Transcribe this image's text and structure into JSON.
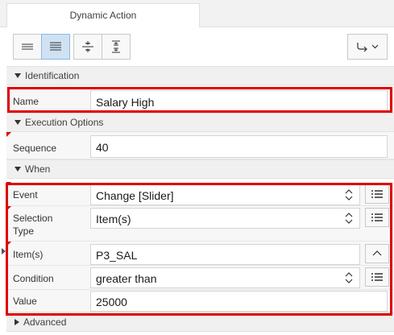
{
  "tab": {
    "label": "Dynamic Action"
  },
  "toolbar": {
    "buttons": [
      {
        "icon": "collapse-lines-icon",
        "active": false
      },
      {
        "icon": "expand-lines-icon",
        "active": true
      },
      {
        "icon": "collapse-vertical-icon",
        "active": false
      },
      {
        "icon": "expand-vertical-icon",
        "active": false
      },
      {
        "icon": "goto-arrow-icon",
        "active": false
      }
    ]
  },
  "sections": {
    "identification": "Identification",
    "execution": "Execution Options",
    "when": "When",
    "advanced": "Advanced"
  },
  "fields": {
    "name": {
      "label": "Name",
      "value": "Salary High"
    },
    "sequence": {
      "label": "Sequence",
      "value": "40"
    },
    "event": {
      "label": "Event",
      "value": "Change [Slider]"
    },
    "selection_type": {
      "label": "Selection Type",
      "value": "Item(s)"
    },
    "items": {
      "label": "Item(s)",
      "value": "P3_SAL"
    },
    "condition": {
      "label": "Condition",
      "value": "greater than"
    },
    "value": {
      "label": "Value",
      "value": "25000"
    }
  },
  "colors": {
    "highlight": "#e00000",
    "required": "#dd0000",
    "active_button": "#cfe2f3"
  }
}
